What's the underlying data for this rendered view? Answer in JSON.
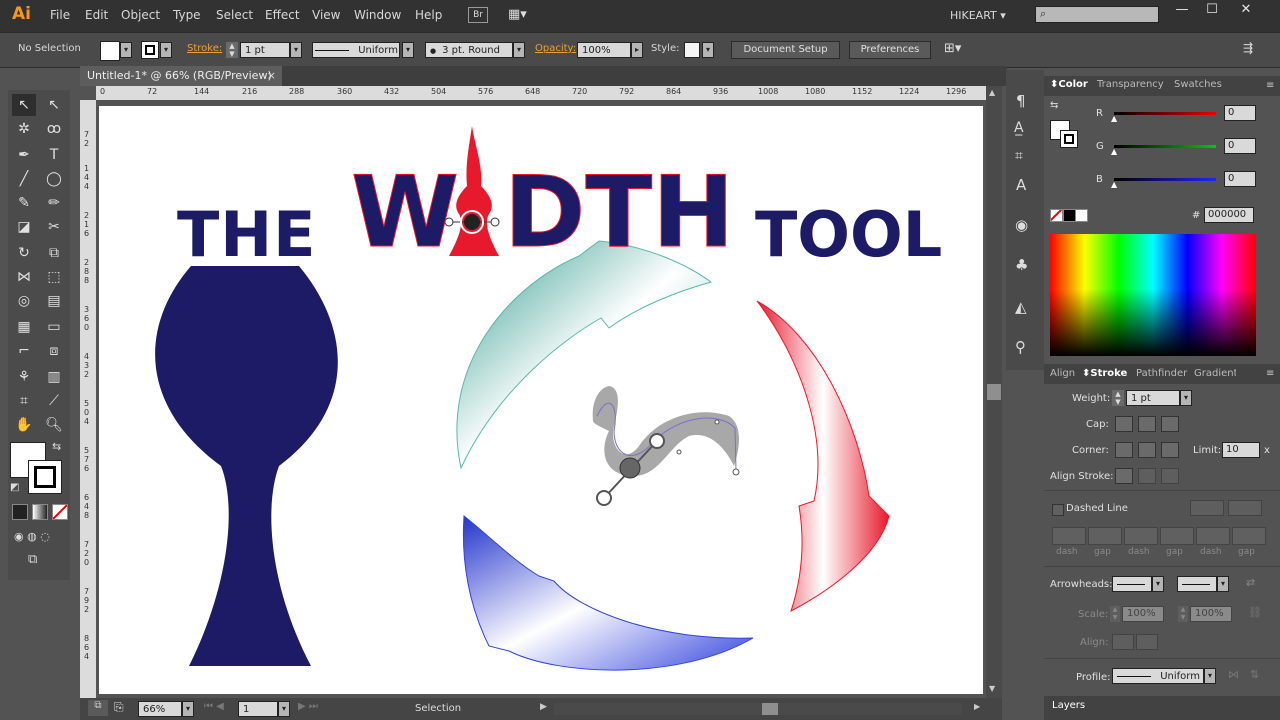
{
  "app": {
    "logo": "Ai",
    "workspace": "HIKEART",
    "bridge_label": "Br"
  },
  "menu": [
    "File",
    "Edit",
    "Object",
    "Type",
    "Select",
    "Effect",
    "View",
    "Window",
    "Help"
  ],
  "control_bar": {
    "selection_status": "No Selection",
    "stroke_label": "Stroke:",
    "stroke_weight": "1 pt",
    "profile": "Uniform",
    "brush": "3 pt. Round",
    "opacity_label": "Opacity:",
    "opacity": "100%",
    "style_label": "Style:",
    "document_setup": "Document Setup",
    "preferences": "Preferences"
  },
  "document_tab": {
    "title": "Untitled-1* @ 66% (RGB/Preview)",
    "close": "×"
  },
  "ruler": {
    "h_ticks": [
      "0",
      "72",
      "144",
      "216",
      "288",
      "360",
      "432",
      "504",
      "576",
      "648",
      "720",
      "792",
      "864",
      "936",
      "1008",
      "1080",
      "1152",
      "1224",
      "1296"
    ],
    "v_ticks": [
      "7\n2",
      "1\n4\n4",
      "2\n1\n6",
      "2\n8\n8",
      "3\n6\n0",
      "4\n3\n2",
      "5\n0\n4",
      "5\n7\n6",
      "6\n4\n8",
      "7\n2\n0",
      "7\n9\n2",
      "8\n6\n4"
    ]
  },
  "artwork": {
    "word_the": "THE",
    "word_w": "W",
    "word_dth": "DTH",
    "word_tool": "TOOL",
    "colors": {
      "navy": "#1d1a66",
      "red": "#e8192c",
      "teal": "#58b8ab",
      "blue": "#2f3fe0"
    }
  },
  "status_bar": {
    "zoom": "66%",
    "artboard": "1",
    "tool": "Selection"
  },
  "color_panel": {
    "tabs": [
      "Color",
      "Transparency",
      "Swatches"
    ],
    "channels": [
      {
        "label": "R",
        "value": "0"
      },
      {
        "label": "G",
        "value": "0"
      },
      {
        "label": "B",
        "value": "0"
      }
    ],
    "hex_label": "#",
    "hex": "000000"
  },
  "stroke_panel": {
    "tabs": [
      "Align",
      "Stroke",
      "Pathfinder",
      "Gradient"
    ],
    "weight_label": "Weight:",
    "weight": "1 pt",
    "cap_label": "Cap:",
    "corner_label": "Corner:",
    "limit_label": "Limit:",
    "limit": "10",
    "limit_unit": "x",
    "align_label": "Align Stroke:",
    "dashed_label": "Dashed Line",
    "dash_labels": [
      "dash",
      "gap",
      "dash",
      "gap",
      "dash",
      "gap"
    ],
    "arrowheads_label": "Arrowheads:",
    "scale_label": "Scale:",
    "scale_1": "100%",
    "scale_2": "100%",
    "align2_label": "Align:",
    "profile_label": "Profile:",
    "profile": "Uniform"
  },
  "layers_panel": {
    "title": "Layers"
  }
}
